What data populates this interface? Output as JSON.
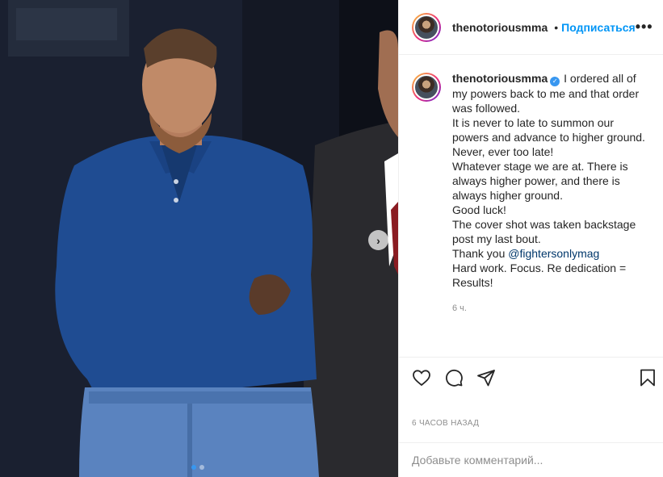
{
  "post": {
    "username": "thenotoriousmma",
    "separator": "•",
    "follow_label": "Подписаться",
    "more_icon": "more-options-icon",
    "verified_icon": "verified-badge-icon"
  },
  "caption": {
    "username": "thenotoriousmma",
    "lines": [
      "I ordered all of my powers back to me and that order was followed.",
      "It is never to late to summon our powers and advance to higher ground.",
      "Never, ever too late!",
      "Whatever stage we are at. There is always higher power, and there is always higher ground.",
      "Good luck!",
      "The cover shot was taken backstage post my last bout."
    ],
    "thanks_prefix": "Thank you",
    "mention": "@fightersonlymag",
    "closing_lines": [
      "Hard work. Focus. Re dedication =",
      "Results!"
    ],
    "age": "6 ч."
  },
  "actions": {
    "like_icon": "heart-icon",
    "comment_icon": "comment-icon",
    "share_icon": "share-icon",
    "save_icon": "bookmark-icon"
  },
  "timestamp": "6 ЧАСОВ НАЗАД",
  "comment": {
    "placeholder": "Добавьте комментарий...",
    "value": ""
  },
  "carousel": {
    "next_icon": "chevron-right-icon",
    "total_slides": 2,
    "current_slide": 1
  },
  "colors": {
    "accent": "#0095f6",
    "mention": "#00376b",
    "muted": "#8e8e8e",
    "border": "#efefef"
  }
}
